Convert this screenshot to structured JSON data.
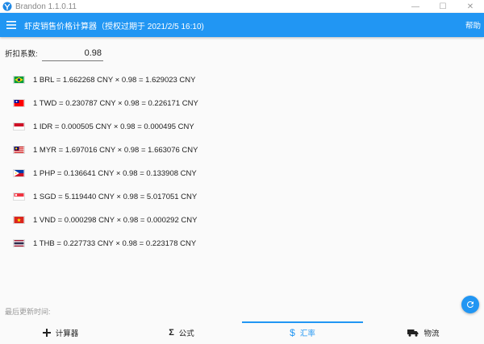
{
  "window": {
    "title": "Brandon 1.1.0.11",
    "controls": [
      "—",
      "☐",
      "✕"
    ]
  },
  "appbar": {
    "title": "虾皮销售价格计算器（授权过期于 2021/2/5 16:10)",
    "help_label": "帮助"
  },
  "discount": {
    "label": "折扣系数:",
    "value": "0.98"
  },
  "rates": [
    {
      "flag": "brazil-flag-icon",
      "text": "1 BRL = 1.662268 CNY × 0.98 = 1.629023 CNY"
    },
    {
      "flag": "taiwan-flag-icon",
      "text": "1 TWD = 0.230787 CNY × 0.98 = 0.226171 CNY"
    },
    {
      "flag": "indonesia-flag-icon",
      "text": "1 IDR = 0.000505 CNY × 0.98 = 0.000495 CNY"
    },
    {
      "flag": "malaysia-flag-icon",
      "text": "1 MYR = 1.697016 CNY × 0.98 = 1.663076 CNY"
    },
    {
      "flag": "philippines-flag-icon",
      "text": "1 PHP = 0.136641 CNY × 0.98 = 0.133908 CNY"
    },
    {
      "flag": "singapore-flag-icon",
      "text": "1 SGD = 5.119440 CNY × 0.98 = 5.017051 CNY"
    },
    {
      "flag": "vietnam-flag-icon",
      "text": "1 VND = 0.000298 CNY × 0.98 = 0.000292 CNY"
    },
    {
      "flag": "thailand-flag-icon",
      "text": "1 THB = 0.227733 CNY × 0.98 = 0.223178 CNY"
    }
  ],
  "footer": {
    "last_update_label": "最后更新时间:"
  },
  "nav": {
    "tabs": [
      {
        "label": "计算器",
        "icon": "plus-icon"
      },
      {
        "label": "公式",
        "icon": "sigma-icon"
      },
      {
        "label": "汇率",
        "icon": "dollar-icon",
        "active": true
      },
      {
        "label": "物流",
        "icon": "truck-icon"
      }
    ]
  },
  "colors": {
    "accent": "#2196f3",
    "background": "#fafafa"
  }
}
